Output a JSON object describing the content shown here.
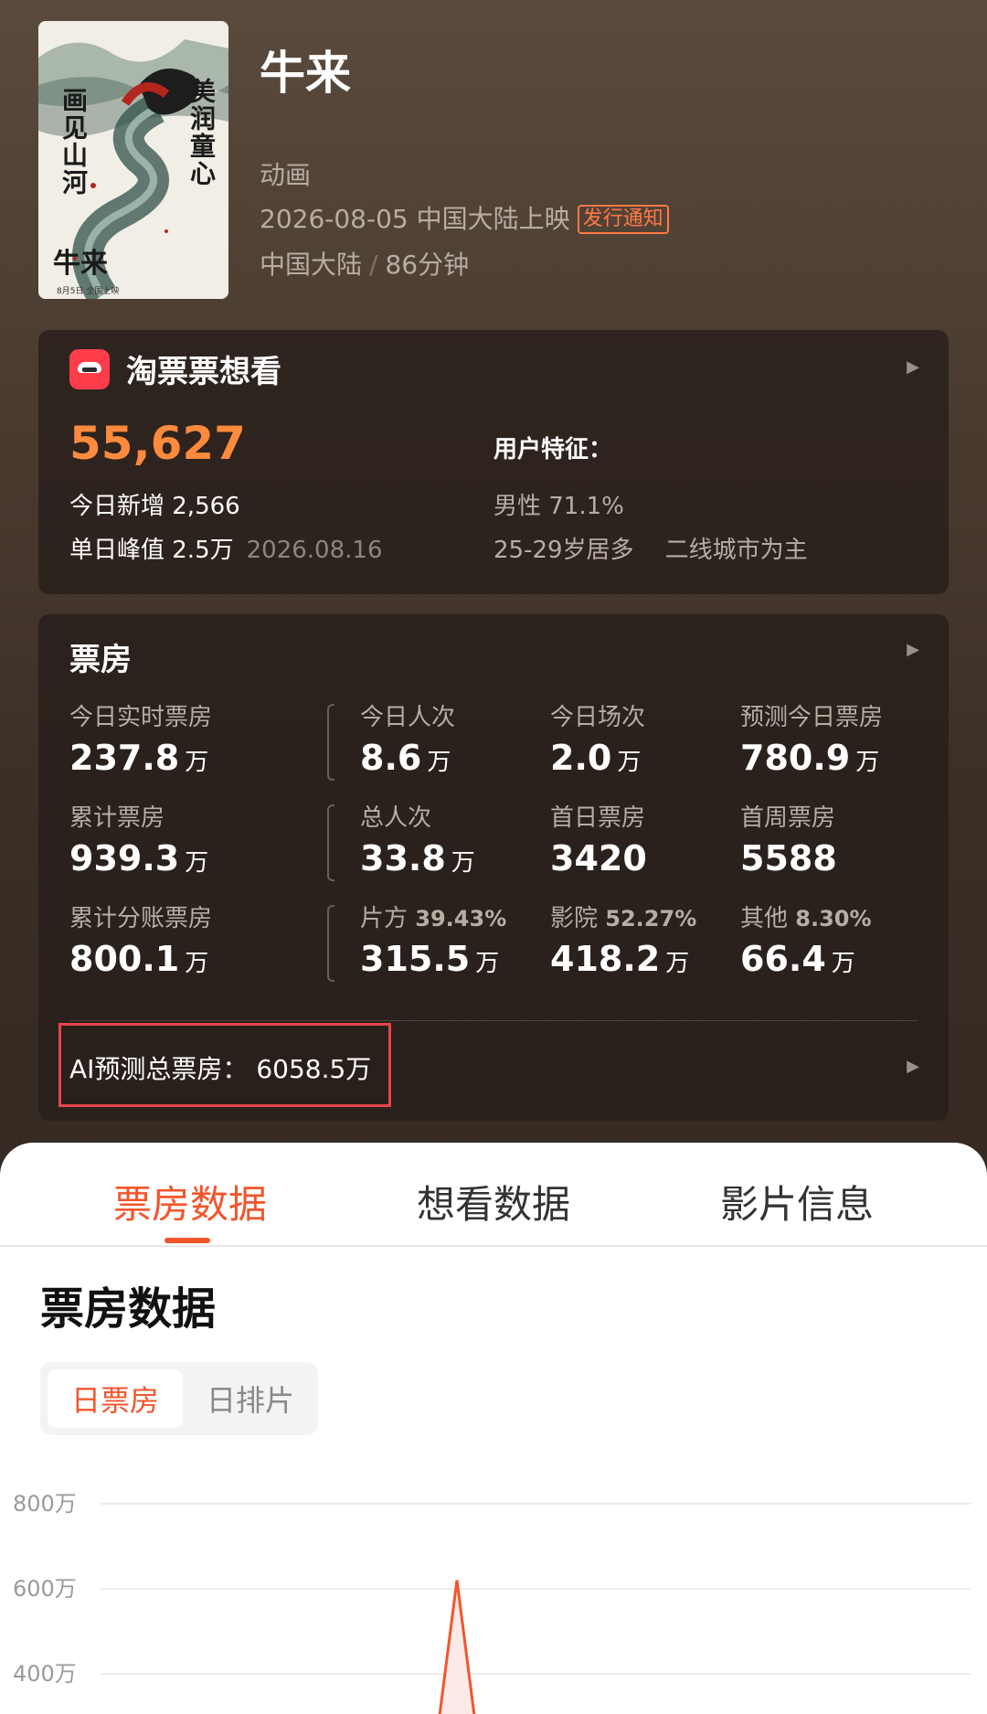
{
  "movie": {
    "title": "牛来",
    "genre": "动画",
    "release": "2026-08-05 中国大陆上映",
    "release_badge": "发行通知",
    "country": "中国大陆",
    "duration": "86分钟",
    "poster": {
      "right_text": "美润童心",
      "left_text": "画见山河",
      "title_text": "牛来",
      "date_text": "8月5日 全国上映"
    }
  },
  "want": {
    "title": "淘票票想看",
    "count": "55,627",
    "today_new": "今日新增 2,566",
    "peak": "单日峰值 2.5万",
    "peak_date": "2026.08.16",
    "user_title": "用户特征：",
    "gender": "男性 71.1%",
    "age": "25-29岁居多",
    "city": "二线城市为主"
  },
  "boxoffice": {
    "title": "票房",
    "unit": "万",
    "stats": [
      {
        "label": "今日实时票房",
        "value": "237.8",
        "unit": "万"
      },
      {
        "label": "今日人次",
        "value": "8.6",
        "unit": "万"
      },
      {
        "label": "今日场次",
        "value": "2.0",
        "unit": "万"
      },
      {
        "label": "预测今日票房",
        "value": "780.9",
        "unit": "万"
      },
      {
        "label": "累计票房",
        "value": "939.3",
        "unit": "万"
      },
      {
        "label": "总人次",
        "value": "33.8",
        "unit": "万"
      },
      {
        "label": "首日票房",
        "value": "3420",
        "unit": ""
      },
      {
        "label": "首周票房",
        "value": "5588",
        "unit": ""
      },
      {
        "label": "累计分账票房",
        "value": "800.1",
        "unit": "万"
      },
      {
        "label": "片方",
        "pct": "39.43%",
        "value": "315.5",
        "unit": "万"
      },
      {
        "label": "影院",
        "pct": "52.27%",
        "value": "418.2",
        "unit": "万"
      },
      {
        "label": "其他",
        "pct": "8.30%",
        "value": "66.4",
        "unit": "万"
      }
    ],
    "ai_forecast": "AI预测总票房：  6058.5万"
  },
  "tabs": [
    {
      "label": "票房数据",
      "active": true
    },
    {
      "label": "想看数据",
      "active": false
    },
    {
      "label": "影片信息",
      "active": false
    }
  ],
  "section_title": "票房数据",
  "toggle": {
    "on": "日票房",
    "off": "日排片"
  },
  "colors": {
    "accent": "#f2552c",
    "orange_num": "#ff8a3d",
    "badge": "#ff7a45",
    "highlight_box": "#e8454b"
  },
  "chart_data": {
    "type": "line",
    "y_ticks": [
      "800万",
      "600万",
      "400万"
    ],
    "ylim": [
      0,
      800
    ],
    "series": [
      {
        "values": [
          0,
          620,
          0
        ]
      }
    ]
  }
}
